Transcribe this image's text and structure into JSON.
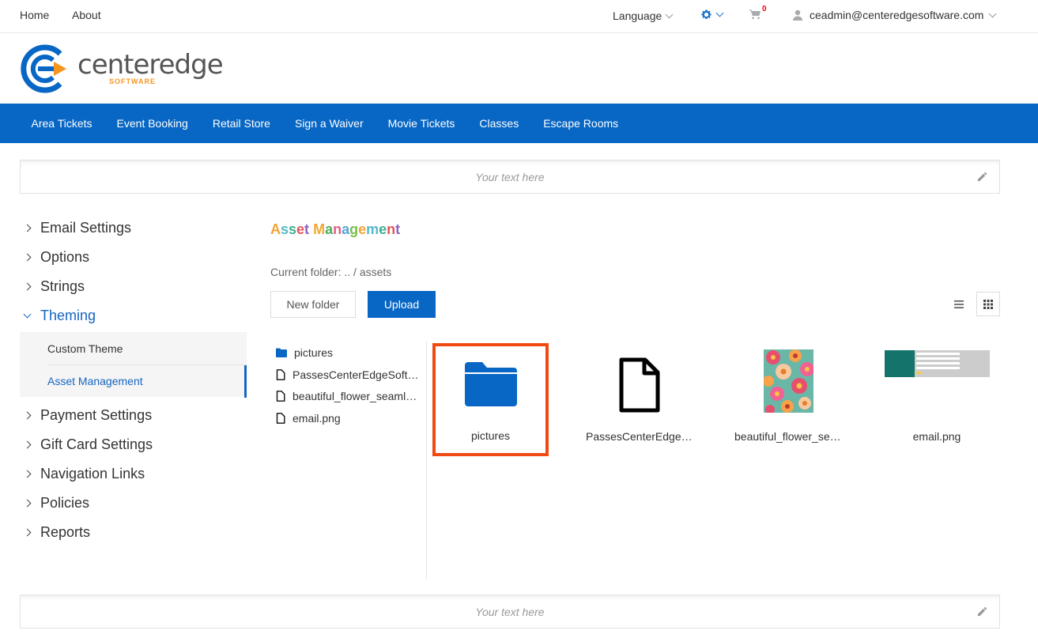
{
  "topbar": {
    "home": "Home",
    "about": "About",
    "language": "Language",
    "cart_count": "0",
    "user_email": "ceadmin@centeredgesoftware.com"
  },
  "logo": {
    "word": "centeredge",
    "sub": "SOFTWARE"
  },
  "nav": [
    "Area Tickets",
    "Event Booking",
    "Retail Store",
    "Sign a Waiver",
    "Movie Tickets",
    "Classes",
    "Escape Rooms"
  ],
  "banner_top": {
    "placeholder": "Your text here"
  },
  "banner_bottom": {
    "placeholder": "Your text here"
  },
  "sidebar": {
    "items": [
      {
        "label": "Email Settings"
      },
      {
        "label": "Options"
      },
      {
        "label": "Strings"
      },
      {
        "label": "Theming"
      },
      {
        "label": "Payment Settings"
      },
      {
        "label": "Gift Card Settings"
      },
      {
        "label": "Navigation Links"
      },
      {
        "label": "Policies"
      },
      {
        "label": "Reports"
      }
    ],
    "theming_sub": [
      {
        "label": "Custom Theme"
      },
      {
        "label": "Asset Management"
      }
    ]
  },
  "main": {
    "title": "Asset Management",
    "title_colors": [
      "#f2a33a",
      "#55b9c9",
      "#3cb08f",
      "#e4555a",
      "#8c64c2",
      "#f0a830",
      "#4cae5a",
      "#e65b88",
      "#50a7d8",
      "#7abf4a"
    ],
    "current_folder": "Current folder: .. / assets",
    "new_folder": "New folder",
    "upload": "Upload",
    "tree": [
      {
        "name": "pictures",
        "icon": "folder-icon"
      },
      {
        "name": "PassesCenterEdgeSoftware.pdf",
        "icon": "file-icon"
      },
      {
        "name": "beautiful_flower_seamless_pattern.jpg",
        "icon": "file-icon"
      },
      {
        "name": "email.png",
        "icon": "file-icon"
      }
    ],
    "tiles": [
      {
        "name": "pictures"
      },
      {
        "name": "PassesCenterEdgeSoftware.pdf"
      },
      {
        "name": "beautiful_flower_seamless_pattern.jpg"
      },
      {
        "name": "email.png"
      }
    ]
  },
  "colors": {
    "brand_blue": "#0867c4",
    "selection_orange": "#f04a12",
    "logo_orange": "#f7941e"
  }
}
